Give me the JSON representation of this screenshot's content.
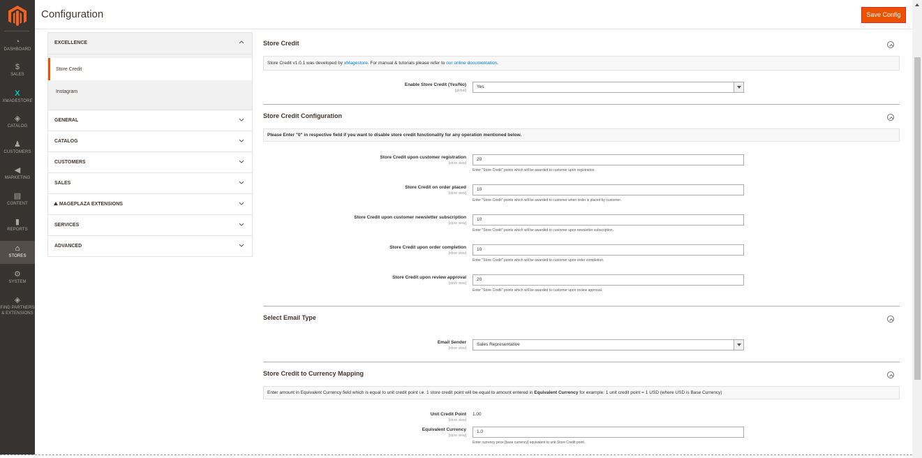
{
  "menu": {
    "items": [
      {
        "label": "DASHBOARD",
        "icon": "dashboard-icon",
        "glyph": "◔"
      },
      {
        "label": "SALES",
        "icon": "dollar-icon",
        "glyph": "$"
      },
      {
        "label": "XMAGESTORE",
        "icon": "xmagestore-icon",
        "glyph": "X"
      },
      {
        "label": "CATALOG",
        "icon": "box-icon",
        "glyph": "◈"
      },
      {
        "label": "CUSTOMERS",
        "icon": "person-icon",
        "glyph": "♟"
      },
      {
        "label": "MARKETING",
        "icon": "megaphone-icon",
        "glyph": "◀"
      },
      {
        "label": "CONTENT",
        "icon": "content-icon",
        "glyph": "▤"
      },
      {
        "label": "REPORTS",
        "icon": "bar-chart-icon",
        "glyph": "▮"
      },
      {
        "label": "STORES",
        "icon": "store-icon",
        "glyph": "⌂"
      },
      {
        "label": "SYSTEM",
        "icon": "gear-icon",
        "glyph": "⚙"
      },
      {
        "label": "FIND PARTNERS",
        "label2": "& EXTENSIONS",
        "icon": "extensions-icon",
        "glyph": "◈"
      }
    ]
  },
  "header": {
    "title": "Configuration",
    "save_label": "Save Config"
  },
  "nav": {
    "excellence": "EXCELLENCE",
    "sub_items": [
      "Store Credit",
      "Instagram"
    ],
    "groups": [
      "GENERAL",
      "CATALOG",
      "CUSTOMERS",
      "SALES",
      "MAGEPLAZA EXTENSIONS",
      "SERVICES",
      "ADVANCED"
    ]
  },
  "store_credit": {
    "title": "Store Credit",
    "note_prefix": "Store Credit v1.0.1 was developed by ",
    "note_link1": "xMagestore",
    "note_middle": ". For manual & tutorials please refer to ",
    "note_link2": "our online documentation",
    "note_suffix": ".",
    "enable_label": "Enable Store Credit (Yes/No)",
    "enable_scope": "[global]",
    "enable_value": "Yes"
  },
  "config": {
    "title": "Store Credit Configuration",
    "note": "Please Enter \"0\" in respective field if you want to disable store credit functionality for any operation mentioned below.",
    "fields": [
      {
        "label": "Store Credit upon customer registration",
        "scope": "[store view]",
        "value": "20",
        "hint": "Enter \"Store Credit\" points which will be awarded to customer upon registration."
      },
      {
        "label": "Store Credit on order placed",
        "scope": "[store view]",
        "value": "10",
        "hint": "Enter \"Store Credit\" points which will be awarded to customer when order is placed by customer."
      },
      {
        "label": "Store Credit upon customer newsletter subscription",
        "scope": "[store view]",
        "value": "10",
        "hint": "Enter \"Store Credit\" points which will be awarded to customer upon newsletter subscription."
      },
      {
        "label": "Store Credit upon order completion",
        "scope": "[store view]",
        "value": "10",
        "hint": "Enter \"Store Credit\" points which will be awarded to customer upon order completion."
      },
      {
        "label": "Store Credit upon review approval",
        "scope": "[store view]",
        "value": "20",
        "hint": "Enter \"Store Credit\" points which will be awarded to customer upon review approval."
      }
    ]
  },
  "email": {
    "title": "Select Email Type",
    "sender_label": "Email Sender",
    "sender_scope": "[store view]",
    "sender_value": "Sales Representative"
  },
  "mapping": {
    "title": "Store Credit to Currency Mapping",
    "note_prefix": "Enter amount in Equivalent Currency field which is equal to unit credit point i.e. 1 store credit point will be equal to amount entered in ",
    "note_bold": "Equivalent Currency",
    "note_suffix": " for example: 1 unit credit point = 1 USD (where USD is Base Currency)",
    "unit_label": "Unit Credit Point",
    "unit_scope": "[store view]",
    "unit_value": "1.00",
    "equiv_label": "Equivalent Currency",
    "equiv_scope": "[store view]",
    "equiv_value": "1.0",
    "equiv_hint": "Enter currency price [base currency] equivalent to unit Store Credit point."
  },
  "colors": {
    "accent": "#eb5202",
    "menu_bg": "#373330",
    "link": "#007bdb"
  }
}
